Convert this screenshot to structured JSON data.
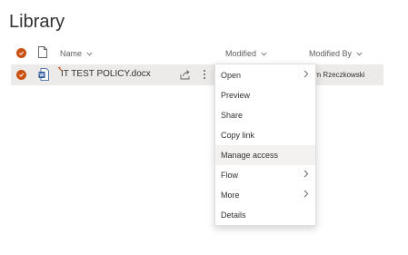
{
  "page": {
    "title": "Library"
  },
  "columns": {
    "name": "Name",
    "modified": "Modified",
    "modified_by": "Modified By"
  },
  "file": {
    "name": "IT TEST POLICY.docx",
    "modified_by_visible": "om Rzeczkowski",
    "icon": "word-doc-icon"
  },
  "menu": {
    "items": [
      {
        "label": "Open",
        "submenu": true
      },
      {
        "label": "Preview",
        "submenu": false
      },
      {
        "label": "Share",
        "submenu": false
      },
      {
        "label": "Copy link",
        "submenu": false
      },
      {
        "label": "Manage access",
        "submenu": false,
        "highlighted": true
      },
      {
        "label": "Flow",
        "submenu": true
      },
      {
        "label": "More",
        "submenu": true
      },
      {
        "label": "Details",
        "submenu": false
      }
    ]
  },
  "colors": {
    "accent": "#ca5010",
    "word_blue": "#2b579a",
    "row_selected": "#edebe9",
    "menu_highlight": "#f3f2f1"
  }
}
